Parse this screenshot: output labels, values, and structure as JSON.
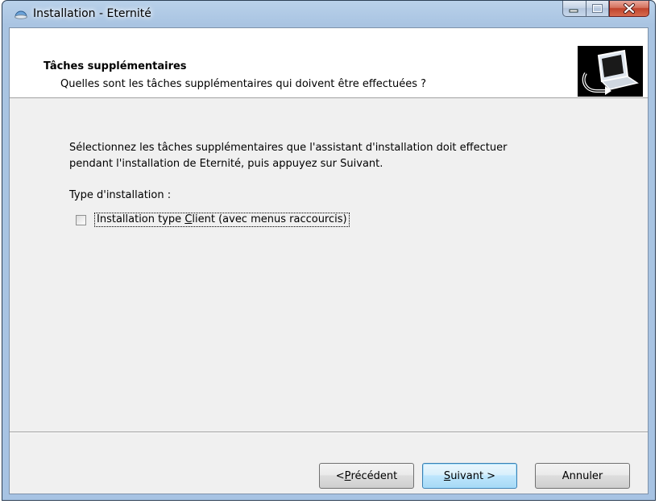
{
  "window": {
    "title": "Installation - Eternité",
    "caption_buttons": {
      "minimize": "minimize-icon",
      "maximize": "maximize-icon",
      "close": "close-icon"
    }
  },
  "header": {
    "title": "Tâches supplémentaires",
    "subtitle": "Quelles sont les tâches supplémentaires qui doivent être effectuées ?",
    "image_icon": "computer-install-icon"
  },
  "body": {
    "description_line1": "Sélectionnez les tâches supplémentaires que l'assistant d'installation doit effectuer",
    "description_line2": "pendant l'installation de Eternité, puis appuyez sur Suivant.",
    "type_label": "Type d'installation :",
    "task": {
      "label_before": "Installation type ",
      "label_accel": "C",
      "label_after": "lient (avec menus raccourcis)",
      "checked": false
    }
  },
  "buttons": {
    "prev_before": "< ",
    "prev_accel": "P",
    "prev_after": "récédent",
    "next_accel": "S",
    "next_after": "uivant >",
    "cancel": "Annuler"
  },
  "colors": {
    "frame": "#a9c4e2",
    "client": "#f0f0f0",
    "header": "#ffffff",
    "close_button": "#c0432c"
  }
}
